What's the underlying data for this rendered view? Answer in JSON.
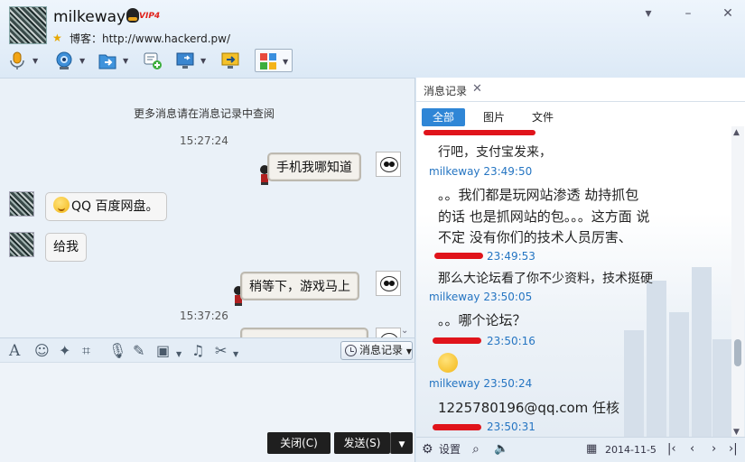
{
  "header": {
    "contact_name": "milkeway",
    "vip_text": "VIP4",
    "blog_label": "博客：http://www.hackerd.pw/",
    "window_buttons": [
      "restore-icon",
      "minimize-icon",
      "close-icon"
    ]
  },
  "toolbar": {
    "items": [
      "microphone-icon",
      "video-camera-icon",
      "send-file-icon",
      "screen-share-icon",
      "remote-desktop-icon",
      "apps-grid-icon"
    ]
  },
  "chat": {
    "more_messages": "更多消息请在消息记录中查阅",
    "time_1": "15:27:24",
    "msg_1": "手机我哪知道",
    "msg_2": "QQ 百度网盘。",
    "msg_3": "给我",
    "msg_4": "稍等下，游戏马上",
    "time_2": "15:37:26"
  },
  "input_toolbar": {
    "icons": [
      "font-icon",
      "emoji-icon",
      "magic-icon",
      "screenshot-icon",
      "voice-icon",
      "edit-icon",
      "image-icon",
      "music-icon",
      "scissors-icon"
    ],
    "history_button": "消息记录"
  },
  "actions": {
    "close_label": "关闭(C)",
    "send_label": "发送(S)"
  },
  "history": {
    "tab_label": "消息记录",
    "filters": [
      "全部",
      "图片",
      "文件"
    ],
    "entries": {
      "t1": "行吧，支付宝发来，",
      "m1": "milkeway 23:49:50",
      "t2a": "。。我们都是玩网站渗透        劫持抓包",
      "t2b": "的话  也是抓网站的包。。。这方面  说",
      "t2c": "不定 没有你们的技术人员厉害、",
      "m2": "23:49:53",
      "t3": "那么大论坛看了你不少资料，技术挺硬",
      "m3": "milkeway 23:50:05",
      "t4": "。。哪个论坛？",
      "m4": "23:50:16",
      "m5": "milkeway 23:50:24",
      "t6": "1225780196@qq.com  任核",
      "m6": "23:50:31"
    },
    "footer": {
      "settings_label": "设置",
      "date": "2014-11-5"
    }
  },
  "colors": {
    "accent": "#2f86d6",
    "redaction": "#e0141b",
    "meta_blue": "#2575c2"
  }
}
